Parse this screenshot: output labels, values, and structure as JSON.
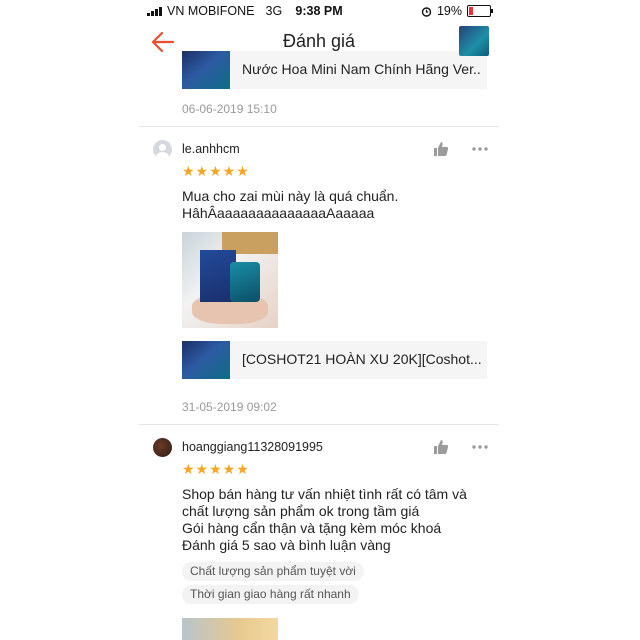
{
  "status_bar": {
    "carrier": "VN MOBIFONE",
    "network": "3G",
    "time": "9:38 PM",
    "battery": "19%"
  },
  "navbar": {
    "title": "Đánh giá",
    "back_icon": "arrow-left-icon"
  },
  "reviews": [
    {
      "product_name": "Nước Hoa Mini Nam Chính Hãng Ver...",
      "date": "06-06-2019 15:10"
    },
    {
      "username": "le.anhhcm",
      "stars": "★★★★★",
      "comment_lines": [
        "Mua cho zai mùi này là quá chuẩn.",
        "HâhÂaaaaaaaaaaaaaaAaaaaa"
      ],
      "product_name": "[COSHOT21 HOÀN XU 20K][Coshot...",
      "date": "31-05-2019 09:02"
    },
    {
      "username": "hoanggiang11328091995",
      "stars": "★★★★★",
      "comment_lines": [
        "Shop bán hàng tư vấn nhiệt tình rất có tâm và",
        "chất lượng sản phẩm ok trong tầm giá",
        "Gói hàng cẩn thận và tặng kèm móc khoá",
        "Đánh giá 5 sao và bình luận vàng"
      ],
      "tags": [
        "Chất lượng sản phẩm tuyệt vời",
        "Thời gian giao hàng rất nhanh"
      ]
    }
  ],
  "colors": {
    "accent": "#ee4d2d",
    "star": "#f5a623",
    "date": "#9a9a9a"
  }
}
